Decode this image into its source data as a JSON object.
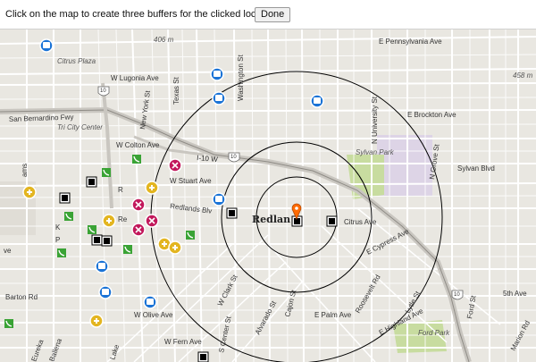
{
  "toolbar": {
    "instruction": "Click on the map to create three buffers for the clicked location.",
    "done_label": "Done"
  },
  "map": {
    "city_label": "Redlan",
    "labels": {
      "pennsylvania": "E Pennsylvania Ave",
      "lugonia": "W Lugonia Ave",
      "brockton": "E Brockton Ave",
      "sanbernardino": "San Bernardino Fwy",
      "colton": "W Colton Ave",
      "i10": "I-10 W",
      "stuart": "W Stuart Ave",
      "redlandsblvd": "Redlands Blv",
      "sylvanblvd": "Sylvan Blvd",
      "sylvanpark": "Sylvan Park",
      "citrus": "Citrus Ave",
      "cypress": "E Cypress Ave",
      "citrusplaza": "Citrus Plaza",
      "tricity": "Tri City Center",
      "barton": "Barton Rd",
      "olive": "W Olive Ave",
      "fern": "W Fern Ave",
      "palm": "E Palm Ave",
      "highland": "E Highland Ave",
      "fifth": "5th Ave",
      "fordpark": "Ford Park",
      "texas": "Texas St",
      "newyork": "New York St",
      "washington": "Washington St",
      "university": "N University St",
      "grove": "N Grove St",
      "clark": "W Clark St",
      "alvarado": "Alvarado St",
      "cajon": "Cajon St",
      "center": "S Center St",
      "lake": "Lake",
      "roosevelt": "Roosevelt Rd",
      "lytle": "Lytle St",
      "ford": "Ford St",
      "marion": "Marion Rd",
      "ballena": "Ballena",
      "eureka": "Eureka",
      "r": "R",
      "re": "Re",
      "ve": "ve",
      "ams": "ams",
      "k": "K",
      "p": "P",
      "elev406": "406 m",
      "elev458": "458 m",
      "shield10a": "10",
      "shield10b": "10",
      "shield10c": "10"
    },
    "buffer_count": 3,
    "colors": {
      "land": "#e9e7e1",
      "block": "#f3f1ec",
      "road": "#ffffff",
      "freeway": "#c9c6c0",
      "park": "#c8dca0",
      "campus": "#ddd4e6",
      "buffer": "#000000",
      "bus_icon": "#1a73d6",
      "medical_icon": "#e3b520",
      "hospital_icon": "#c2185b",
      "phone_icon": "#3aa335"
    }
  }
}
